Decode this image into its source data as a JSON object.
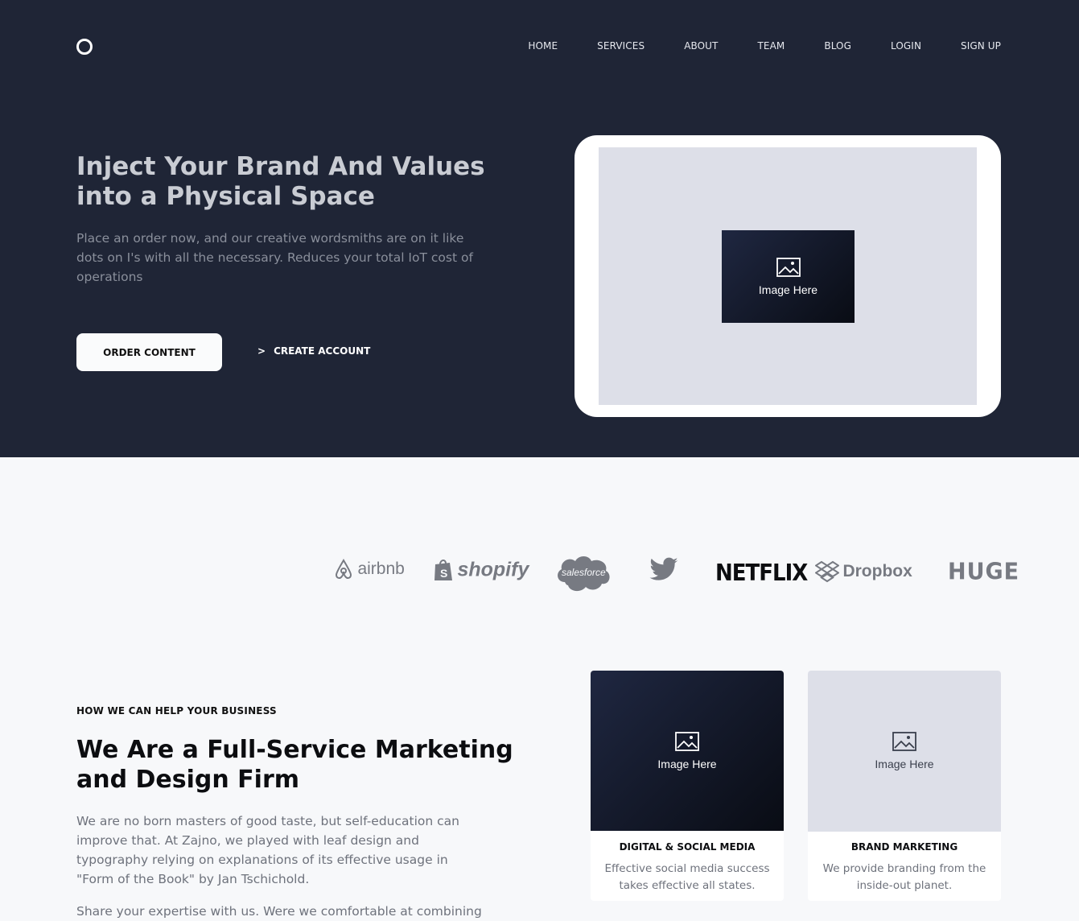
{
  "nav": {
    "items": [
      "HOME",
      "SERVICES",
      "ABOUT",
      "TEAM",
      "BLOG",
      "LOGIN",
      "SIGN UP"
    ]
  },
  "hero": {
    "title": "Inject Your Brand And Values into a Physical Space",
    "subtitle": "Place an order now, and our creative wordsmiths are on it like dots on I's with all the necessary. Reduces your total IoT cost of operations",
    "order_button": "ORDER CONTENT",
    "create_button": "CREATE ACCOUNT",
    "create_prefix": ">",
    "image_label": "Image Here"
  },
  "logos": [
    "airbnb",
    "shopify",
    "salesforce",
    "twitter",
    "NETFLIX",
    "Dropbox",
    "HUGE"
  ],
  "services": {
    "eyebrow": "HOW WE CAN HELP YOUR BUSINESS",
    "title": "We Are a Full-Service Marketing and Design Firm",
    "paragraph1": "We are no born masters of good taste, but self-education can improve that. At Zajno, we played with leaf design and typography relying on explanations of its effective usage in \"Form of the Book\" by Jan Tschichold.",
    "paragraph2": "Share your expertise with us. Were we comfortable at combining",
    "cards": [
      {
        "image_label": "Image Here",
        "title": "DIGITAL & SOCIAL MEDIA",
        "description": "Effective social media success takes effective all states."
      },
      {
        "image_label": "Image Here",
        "title": "BRAND MARKETING",
        "description": "We provide branding from the inside-out planet."
      }
    ]
  },
  "colors": {
    "hero_bg": "#1f2536",
    "page_bg": "#f7f8fa",
    "placeholder_light": "#dddfe8",
    "placeholder_dark": "#0f1320"
  }
}
